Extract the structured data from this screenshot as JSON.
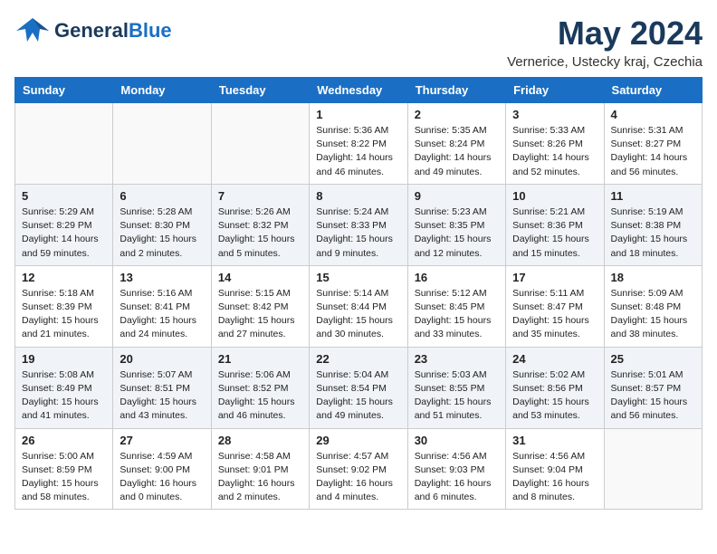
{
  "header": {
    "logo_general": "General",
    "logo_blue": "Blue",
    "month": "May 2024",
    "location": "Vernerice, Ustecky kraj, Czechia"
  },
  "weekdays": [
    "Sunday",
    "Monday",
    "Tuesday",
    "Wednesday",
    "Thursday",
    "Friday",
    "Saturday"
  ],
  "weeks": [
    [
      {
        "day": "",
        "info": ""
      },
      {
        "day": "",
        "info": ""
      },
      {
        "day": "",
        "info": ""
      },
      {
        "day": "1",
        "info": "Sunrise: 5:36 AM\nSunset: 8:22 PM\nDaylight: 14 hours\nand 46 minutes."
      },
      {
        "day": "2",
        "info": "Sunrise: 5:35 AM\nSunset: 8:24 PM\nDaylight: 14 hours\nand 49 minutes."
      },
      {
        "day": "3",
        "info": "Sunrise: 5:33 AM\nSunset: 8:26 PM\nDaylight: 14 hours\nand 52 minutes."
      },
      {
        "day": "4",
        "info": "Sunrise: 5:31 AM\nSunset: 8:27 PM\nDaylight: 14 hours\nand 56 minutes."
      }
    ],
    [
      {
        "day": "5",
        "info": "Sunrise: 5:29 AM\nSunset: 8:29 PM\nDaylight: 14 hours\nand 59 minutes."
      },
      {
        "day": "6",
        "info": "Sunrise: 5:28 AM\nSunset: 8:30 PM\nDaylight: 15 hours\nand 2 minutes."
      },
      {
        "day": "7",
        "info": "Sunrise: 5:26 AM\nSunset: 8:32 PM\nDaylight: 15 hours\nand 5 minutes."
      },
      {
        "day": "8",
        "info": "Sunrise: 5:24 AM\nSunset: 8:33 PM\nDaylight: 15 hours\nand 9 minutes."
      },
      {
        "day": "9",
        "info": "Sunrise: 5:23 AM\nSunset: 8:35 PM\nDaylight: 15 hours\nand 12 minutes."
      },
      {
        "day": "10",
        "info": "Sunrise: 5:21 AM\nSunset: 8:36 PM\nDaylight: 15 hours\nand 15 minutes."
      },
      {
        "day": "11",
        "info": "Sunrise: 5:19 AM\nSunset: 8:38 PM\nDaylight: 15 hours\nand 18 minutes."
      }
    ],
    [
      {
        "day": "12",
        "info": "Sunrise: 5:18 AM\nSunset: 8:39 PM\nDaylight: 15 hours\nand 21 minutes."
      },
      {
        "day": "13",
        "info": "Sunrise: 5:16 AM\nSunset: 8:41 PM\nDaylight: 15 hours\nand 24 minutes."
      },
      {
        "day": "14",
        "info": "Sunrise: 5:15 AM\nSunset: 8:42 PM\nDaylight: 15 hours\nand 27 minutes."
      },
      {
        "day": "15",
        "info": "Sunrise: 5:14 AM\nSunset: 8:44 PM\nDaylight: 15 hours\nand 30 minutes."
      },
      {
        "day": "16",
        "info": "Sunrise: 5:12 AM\nSunset: 8:45 PM\nDaylight: 15 hours\nand 33 minutes."
      },
      {
        "day": "17",
        "info": "Sunrise: 5:11 AM\nSunset: 8:47 PM\nDaylight: 15 hours\nand 35 minutes."
      },
      {
        "day": "18",
        "info": "Sunrise: 5:09 AM\nSunset: 8:48 PM\nDaylight: 15 hours\nand 38 minutes."
      }
    ],
    [
      {
        "day": "19",
        "info": "Sunrise: 5:08 AM\nSunset: 8:49 PM\nDaylight: 15 hours\nand 41 minutes."
      },
      {
        "day": "20",
        "info": "Sunrise: 5:07 AM\nSunset: 8:51 PM\nDaylight: 15 hours\nand 43 minutes."
      },
      {
        "day": "21",
        "info": "Sunrise: 5:06 AM\nSunset: 8:52 PM\nDaylight: 15 hours\nand 46 minutes."
      },
      {
        "day": "22",
        "info": "Sunrise: 5:04 AM\nSunset: 8:54 PM\nDaylight: 15 hours\nand 49 minutes."
      },
      {
        "day": "23",
        "info": "Sunrise: 5:03 AM\nSunset: 8:55 PM\nDaylight: 15 hours\nand 51 minutes."
      },
      {
        "day": "24",
        "info": "Sunrise: 5:02 AM\nSunset: 8:56 PM\nDaylight: 15 hours\nand 53 minutes."
      },
      {
        "day": "25",
        "info": "Sunrise: 5:01 AM\nSunset: 8:57 PM\nDaylight: 15 hours\nand 56 minutes."
      }
    ],
    [
      {
        "day": "26",
        "info": "Sunrise: 5:00 AM\nSunset: 8:59 PM\nDaylight: 15 hours\nand 58 minutes."
      },
      {
        "day": "27",
        "info": "Sunrise: 4:59 AM\nSunset: 9:00 PM\nDaylight: 16 hours\nand 0 minutes."
      },
      {
        "day": "28",
        "info": "Sunrise: 4:58 AM\nSunset: 9:01 PM\nDaylight: 16 hours\nand 2 minutes."
      },
      {
        "day": "29",
        "info": "Sunrise: 4:57 AM\nSunset: 9:02 PM\nDaylight: 16 hours\nand 4 minutes."
      },
      {
        "day": "30",
        "info": "Sunrise: 4:56 AM\nSunset: 9:03 PM\nDaylight: 16 hours\nand 6 minutes."
      },
      {
        "day": "31",
        "info": "Sunrise: 4:56 AM\nSunset: 9:04 PM\nDaylight: 16 hours\nand 8 minutes."
      },
      {
        "day": "",
        "info": ""
      }
    ]
  ]
}
